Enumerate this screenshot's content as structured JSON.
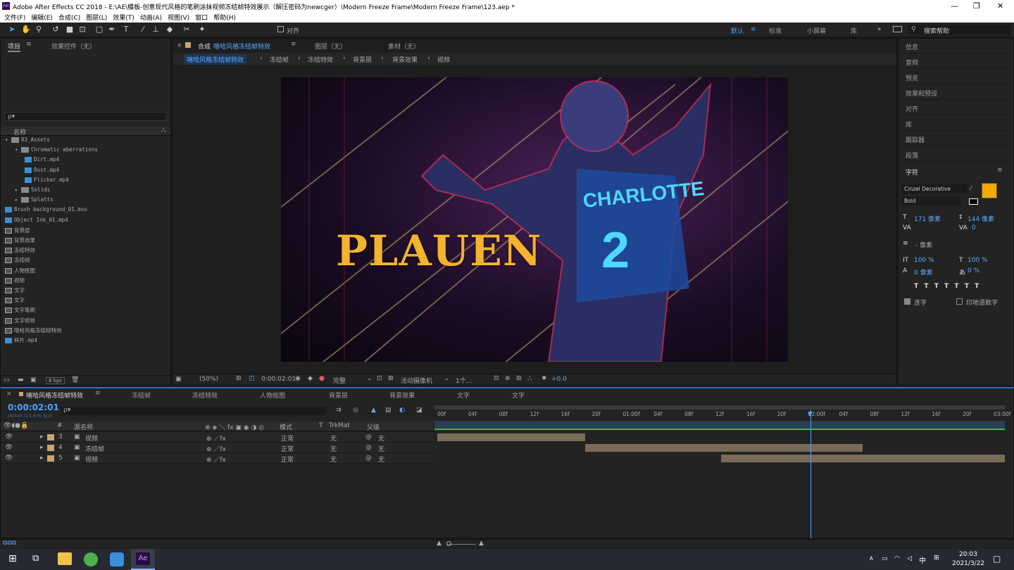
{
  "window": {
    "title": "Adobe After Effects CC 2018 - E:\\AE\\模板-创意现代风格的笔刷涂抹视频冻结帧特效展示（解压密码为newcger）\\Modern Freeze Frame\\Modern Freeze Frame\\123.aep *"
  },
  "menu": [
    "文件(F)",
    "编辑(E)",
    "合成(C)",
    "图层(L)",
    "效果(T)",
    "动画(A)",
    "视图(V)",
    "窗口",
    "帮助(H)"
  ],
  "toolbar": {
    "align_label": "对齐",
    "workspaces": [
      "默认",
      "标准",
      "小屏幕",
      "库"
    ],
    "search_placeholder": "搜索帮助"
  },
  "project": {
    "tab_project": "项目",
    "tab_effects": "效果控件（无）",
    "search_placeholder": "ρ▾",
    "column_name": "名称",
    "bpc": "8 bpc",
    "items": [
      {
        "label": "03_Assets",
        "type": "folder",
        "indent": 0,
        "open": true
      },
      {
        "label": "Chromatic aberrations",
        "type": "folder",
        "indent": 1,
        "open": true
      },
      {
        "label": "Dirt.mp4",
        "type": "file",
        "indent": 2
      },
      {
        "label": "Dust.mp4",
        "type": "file",
        "indent": 2
      },
      {
        "label": "Flicker.mp4",
        "type": "file",
        "indent": 2
      },
      {
        "label": "Solids",
        "type": "folder",
        "indent": 1,
        "open": false
      },
      {
        "label": "Splatts",
        "type": "folder",
        "indent": 1,
        "open": false
      },
      {
        "label": "Brush background_01.mov",
        "type": "file",
        "indent": 0
      },
      {
        "label": "Object Ink_01.mp4",
        "type": "file",
        "indent": 0
      },
      {
        "label": "背景层",
        "type": "comp",
        "indent": 0
      },
      {
        "label": "背景效果",
        "type": "comp",
        "indent": 0
      },
      {
        "label": "冻结特效",
        "type": "comp",
        "indent": 0
      },
      {
        "label": "冻结帧",
        "type": "comp",
        "indent": 0
      },
      {
        "label": "人物抠图",
        "type": "comp",
        "indent": 0
      },
      {
        "label": "视频",
        "type": "comp",
        "indent": 0
      },
      {
        "label": "文字",
        "type": "comp",
        "indent": 0
      },
      {
        "label": "文字",
        "type": "comp",
        "indent": 0
      },
      {
        "label": "文字笔刷",
        "type": "comp",
        "indent": 0
      },
      {
        "label": "文字修效",
        "type": "comp",
        "indent": 0
      },
      {
        "label": "嘻哈风格冻结帧特效",
        "type": "comp",
        "indent": 0
      },
      {
        "label": "样片.mp4",
        "type": "file",
        "indent": 0
      }
    ]
  },
  "viewer": {
    "tab_comp_prefix": "合成",
    "tab_comp": "嘻哈风格冻结帧特效",
    "tab_layer": "图层（无）",
    "tab_footage": "素材（无）",
    "breadcrumbs": [
      "嘻哈风格冻结帧特效",
      "冻结帧",
      "冻结特效",
      "背景层",
      "背景效果",
      "视频"
    ],
    "overlay_title": "PLAUEN",
    "zoom": "(50%)",
    "timecode": "0:00:02:01",
    "quality": "完整",
    "camera": "活动摄像机",
    "views": "1个...",
    "exposure": "+0.0"
  },
  "right_panel": {
    "items": [
      "信息",
      "音频",
      "预览",
      "效果和预设",
      "对齐",
      "库",
      "跟踪器",
      "段落"
    ],
    "character": {
      "title": "字符",
      "font": "Cinzel Decorative",
      "style": "Bold",
      "size": "171 像素",
      "leading": "144 像素",
      "tracking": "0",
      "stroke": "- 像素",
      "vscale": "100 %",
      "hscale": "100 %",
      "baseline": "0 像素",
      "tsume": "0 %",
      "ligatures_label": "连字",
      "hindi_label": "印地语数字",
      "swatch": "#f2a900"
    }
  },
  "timeline": {
    "tabs": [
      "嘻哈风格冻结帧特效",
      "冻结帧",
      "冻结特效",
      "人物抠图",
      "背景层",
      "背景效果",
      "文字",
      "文字"
    ],
    "timecode": "0:00:02:01",
    "fps": "00049 (23.976 fps)",
    "col_num": "#",
    "col_name": "源名称",
    "col_mode": "模式",
    "col_t": "T",
    "col_trkmat": "TrkMat",
    "col_parent": "父级",
    "ruler": [
      "00f",
      "04f",
      "08f",
      "12f",
      "16f",
      "20f",
      "01:00f",
      "04f",
      "08f",
      "12f",
      "16f",
      "20f",
      "02:00f",
      "04f",
      "08f",
      "12f",
      "16f",
      "20f",
      "03:00f"
    ],
    "layers": [
      {
        "num": "3",
        "name": "视频",
        "mode": "正常",
        "trkmat": "无",
        "parent": "无",
        "bar_start": 0.0,
        "bar_end": 0.26
      },
      {
        "num": "4",
        "name": "冻结帧",
        "mode": "正常",
        "trkmat": "无",
        "parent": "无",
        "bar_start": 0.26,
        "bar_end": 0.75
      },
      {
        "num": "5",
        "name": "视频",
        "mode": "正常",
        "trkmat": "无",
        "parent": "无",
        "bar_start": 0.5,
        "bar_end": 1.0
      }
    ]
  },
  "taskbar": {
    "time": "20:03",
    "date": "2021/3/22",
    "ime": "中"
  }
}
